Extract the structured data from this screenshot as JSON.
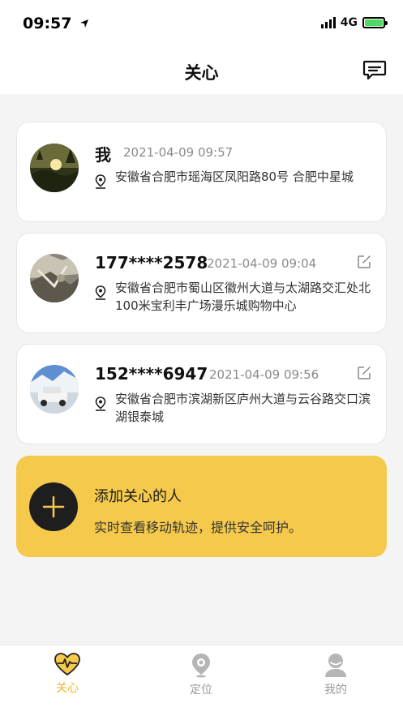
{
  "status_bar": {
    "time": "09:57",
    "network": "4G"
  },
  "nav": {
    "title": "关心"
  },
  "contacts": [
    {
      "name": "我",
      "time": "2021-04-09 09:57",
      "address": "安徽省合肥市瑶海区凤阳路80号 合肥中星城",
      "editable": false
    },
    {
      "name": "177****2578",
      "time": "2021-04-09 09:04",
      "address": "安徽省合肥市蜀山区徽州大道与太湖路交汇处北100米宝利丰广场漫乐城购物中心",
      "editable": true
    },
    {
      "name": "152****6947",
      "time": "2021-04-09 09:56",
      "address": "安徽省合肥市滨湖新区庐州大道与云谷路交口滨湖银泰城",
      "editable": true
    }
  ],
  "add_card": {
    "title": "添加关心的人",
    "subtitle": "实时查看移动轨迹，提供安全呵护。"
  },
  "tabs": [
    {
      "label": "关心",
      "icon": "heart-pulse-icon",
      "active": true
    },
    {
      "label": "定位",
      "icon": "location-pin-icon",
      "active": false
    },
    {
      "label": "我的",
      "icon": "person-icon",
      "active": false
    }
  ],
  "colors": {
    "accent": "#f5c94b",
    "active_tab": "#e8b82c",
    "inactive_tab": "#9a9a9a",
    "background": "#f4f4f4"
  }
}
